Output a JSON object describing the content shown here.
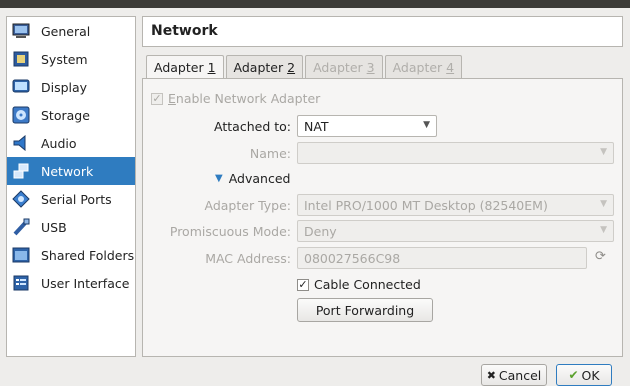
{
  "sidebar": {
    "items": [
      {
        "label": "General",
        "icon": "monitor-icon"
      },
      {
        "label": "System",
        "icon": "chip-icon"
      },
      {
        "label": "Display",
        "icon": "display-icon"
      },
      {
        "label": "Storage",
        "icon": "disk-icon"
      },
      {
        "label": "Audio",
        "icon": "speaker-icon"
      },
      {
        "label": "Network",
        "icon": "network-icon",
        "active": true
      },
      {
        "label": "Serial Ports",
        "icon": "serial-icon"
      },
      {
        "label": "USB",
        "icon": "usb-icon"
      },
      {
        "label": "Shared Folders",
        "icon": "folder-icon"
      },
      {
        "label": "User Interface",
        "icon": "ui-icon"
      }
    ]
  },
  "header": {
    "title": "Network"
  },
  "tabs": [
    {
      "pre": "Adapter ",
      "key": "1"
    },
    {
      "pre": "Adapter ",
      "key": "2"
    },
    {
      "pre": "Adapter ",
      "key": "3"
    },
    {
      "pre": "Adapter ",
      "key": "4"
    }
  ],
  "form": {
    "enable_pre": "",
    "enable_key": "E",
    "enable_post": "nable Network Adapter",
    "attached_label": "Attached to:",
    "attached_value": "NAT",
    "name_label": "Name:",
    "name_value": "",
    "advanced_label": "Advanced",
    "adapter_type_label": "Adapter Type:",
    "adapter_type_value": "Intel PRO/1000 MT Desktop (82540EM)",
    "promisc_label": "Promiscuous Mode:",
    "promisc_value": "Deny",
    "mac_label": "MAC Address:",
    "mac_value": "080027566C98",
    "cable_label": "Cable Connected",
    "port_forwarding_label": "Port Forwarding"
  },
  "footer": {
    "cancel_label": "Cancel",
    "ok_label": "OK"
  },
  "colors": {
    "accent": "#2f7cc0",
    "ok_border": "#2f7cc0"
  }
}
